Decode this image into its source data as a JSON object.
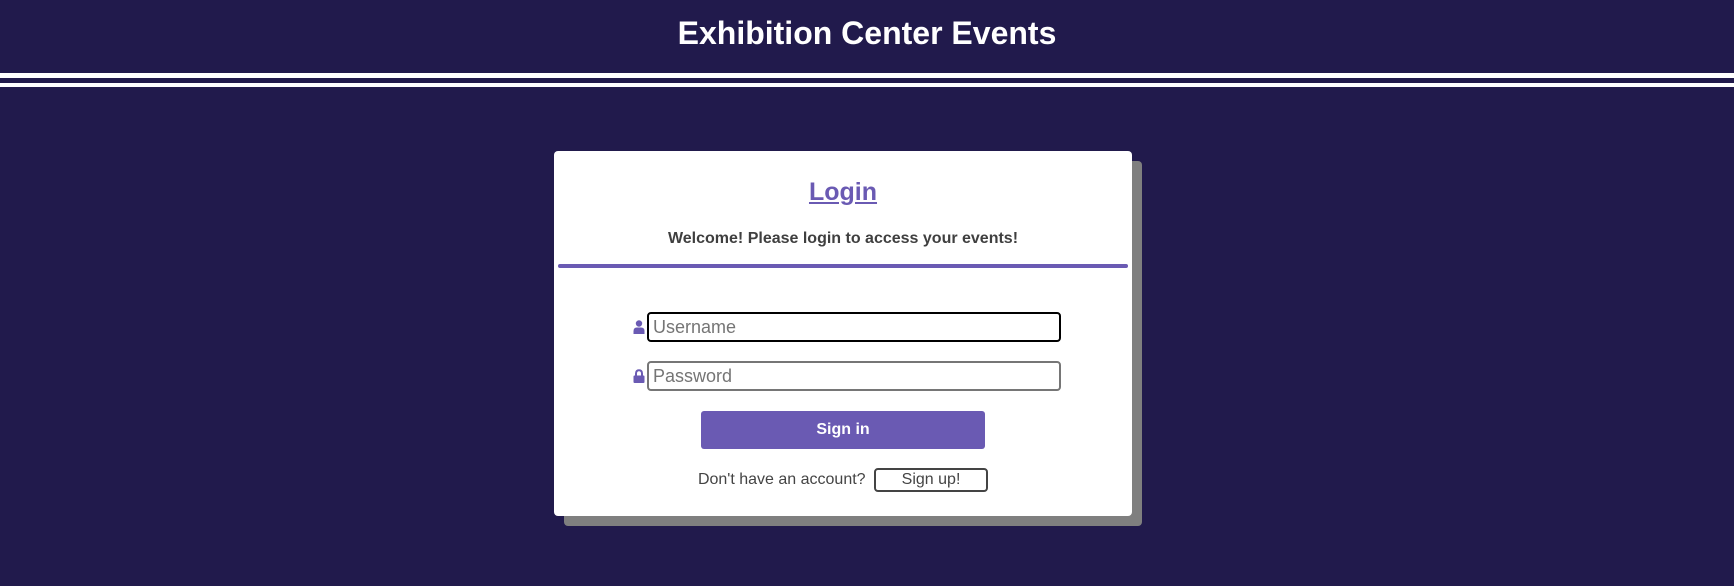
{
  "header": {
    "title": "Exhibition Center Events"
  },
  "login": {
    "title": "Login",
    "welcome": "Welcome! Please login to access your events!",
    "username": {
      "placeholder": "Username",
      "value": "",
      "icon": "user-icon"
    },
    "password": {
      "placeholder": "Password",
      "value": "",
      "icon": "lock-icon"
    },
    "sign_in_label": "Sign in",
    "no_account_text": "Don't have an account?",
    "sign_up_label": "Sign up!"
  },
  "colors": {
    "background": "#211a4c",
    "accent": "#6a5ab3",
    "card": "#ffffff",
    "shadow": "#7f7f7f"
  }
}
